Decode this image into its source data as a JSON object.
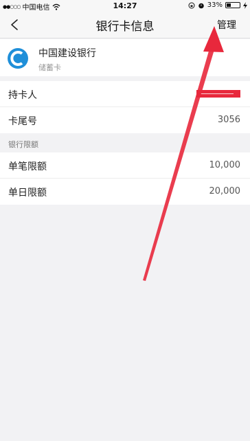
{
  "status_bar": {
    "signal": "●●○○○",
    "carrier": "中国电信",
    "time": "14:27",
    "battery": "33%",
    "wifi_icon": "wifi-icon",
    "lock_icon": "orientation-lock-icon",
    "alarm_icon": "alarm-icon",
    "charging_icon": "charging-icon"
  },
  "nav": {
    "title": "银行卡信息",
    "manage_label": "管理",
    "back_icon": "chevron-left-icon"
  },
  "card": {
    "bank_name": "中国建设银行",
    "card_type": "储蓄卡",
    "logo_color": "#1f8fd9"
  },
  "details": {
    "holder_label": "持卡人",
    "tail_label": "卡尾号",
    "tail_value": "3056"
  },
  "limits": {
    "section_title": "银行限额",
    "single_label": "单笔限额",
    "single_value": "10,000",
    "daily_label": "单日限额",
    "daily_value": "20,000"
  },
  "colors": {
    "annotation_arrow": "#e8283c",
    "background": "#f2f2f4"
  }
}
